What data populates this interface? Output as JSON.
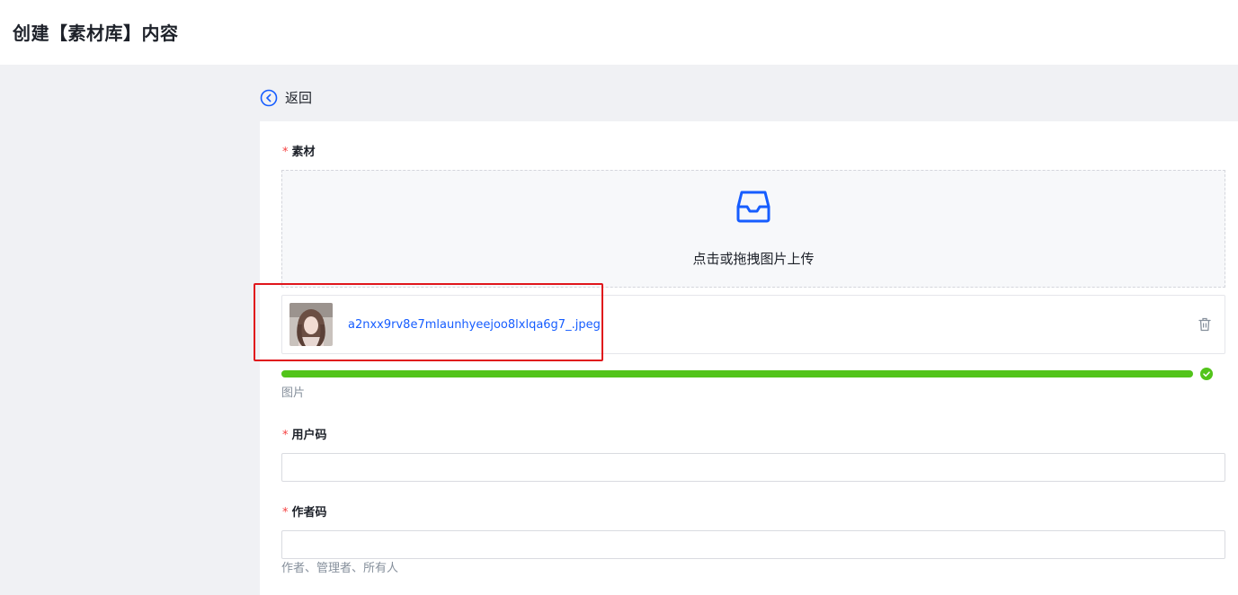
{
  "header": {
    "title": "创建【素材库】内容"
  },
  "nav": {
    "back_label": "返回"
  },
  "form": {
    "material": {
      "label": "素材",
      "required_mark": "*",
      "upload_hint": "点击或拖拽图片上传",
      "file": {
        "name": "a2nxx9rv8e7mlaunhyeejoo8lxlqa6g7_.jpeg",
        "progress": 1.0,
        "status": "done"
      },
      "helper": "图片"
    },
    "user_code": {
      "label": "用户码",
      "required_mark": "*",
      "value": ""
    },
    "author_code": {
      "label": "作者码",
      "required_mark": "*",
      "value": "",
      "helper": "作者、管理者、所有人"
    }
  },
  "icons": {
    "back": "circle-chevron-left-icon",
    "upload": "inbox-icon",
    "delete": "trash-icon",
    "done": "check-circle-icon",
    "thumbnail": "image-thumbnail"
  },
  "colors": {
    "accent": "#165dff",
    "required": "#f53f3f",
    "success": "#52c41a",
    "highlight": "#e0161c"
  }
}
